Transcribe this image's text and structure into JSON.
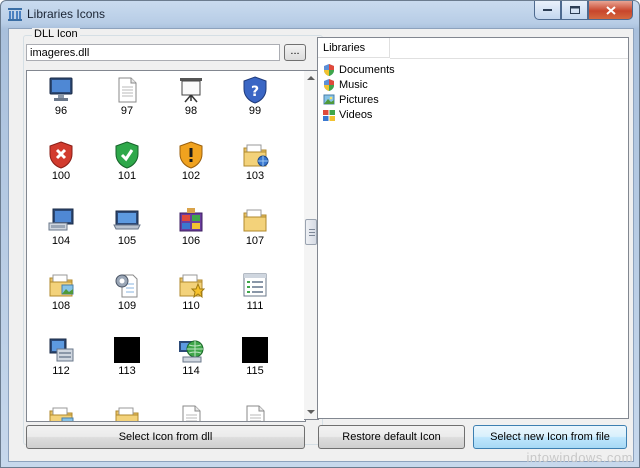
{
  "window": {
    "title": "Libraries Icons"
  },
  "dll_group": {
    "label": "DLL Icon",
    "file_value": "imageres.dll",
    "browse_label": "..."
  },
  "icons": [
    {
      "num": "96",
      "icon": "monitor-icon"
    },
    {
      "num": "97",
      "icon": "document-icon"
    },
    {
      "num": "98",
      "icon": "projector-screen-icon"
    },
    {
      "num": "99",
      "icon": "shield-question-icon"
    },
    {
      "num": "100",
      "icon": "shield-error-icon"
    },
    {
      "num": "101",
      "icon": "shield-check-icon"
    },
    {
      "num": "102",
      "icon": "shield-warning-icon"
    },
    {
      "num": "103",
      "icon": "folder-network-icon"
    },
    {
      "num": "104",
      "icon": "computer-icon"
    },
    {
      "num": "105",
      "icon": "laptop-icon"
    },
    {
      "num": "106",
      "icon": "programs-icon"
    },
    {
      "num": "107",
      "icon": "folder-documents-icon"
    },
    {
      "num": "108",
      "icon": "folder-pictures-icon"
    },
    {
      "num": "109",
      "icon": "settings-document-icon"
    },
    {
      "num": "110",
      "icon": "folder-star-icon"
    },
    {
      "num": "111",
      "icon": "list-window-icon"
    },
    {
      "num": "112",
      "icon": "network-server-icon"
    },
    {
      "num": "113",
      "icon": "black-square-icon"
    },
    {
      "num": "114",
      "icon": "network-globe-icon"
    },
    {
      "num": "115",
      "icon": "black-square-icon"
    }
  ],
  "buttons": {
    "select_from_dll": "Select Icon from dll",
    "restore_default": "Restore default Icon",
    "select_from_file": "Select new Icon from file"
  },
  "libraries": {
    "header": "Libraries",
    "items": [
      {
        "label": "Documents",
        "icon": "documents-library-icon"
      },
      {
        "label": "Music",
        "icon": "music-library-icon"
      },
      {
        "label": "Pictures",
        "icon": "pictures-library-icon"
      },
      {
        "label": "Videos",
        "icon": "videos-library-icon"
      }
    ]
  },
  "watermark": "intowindows.com"
}
